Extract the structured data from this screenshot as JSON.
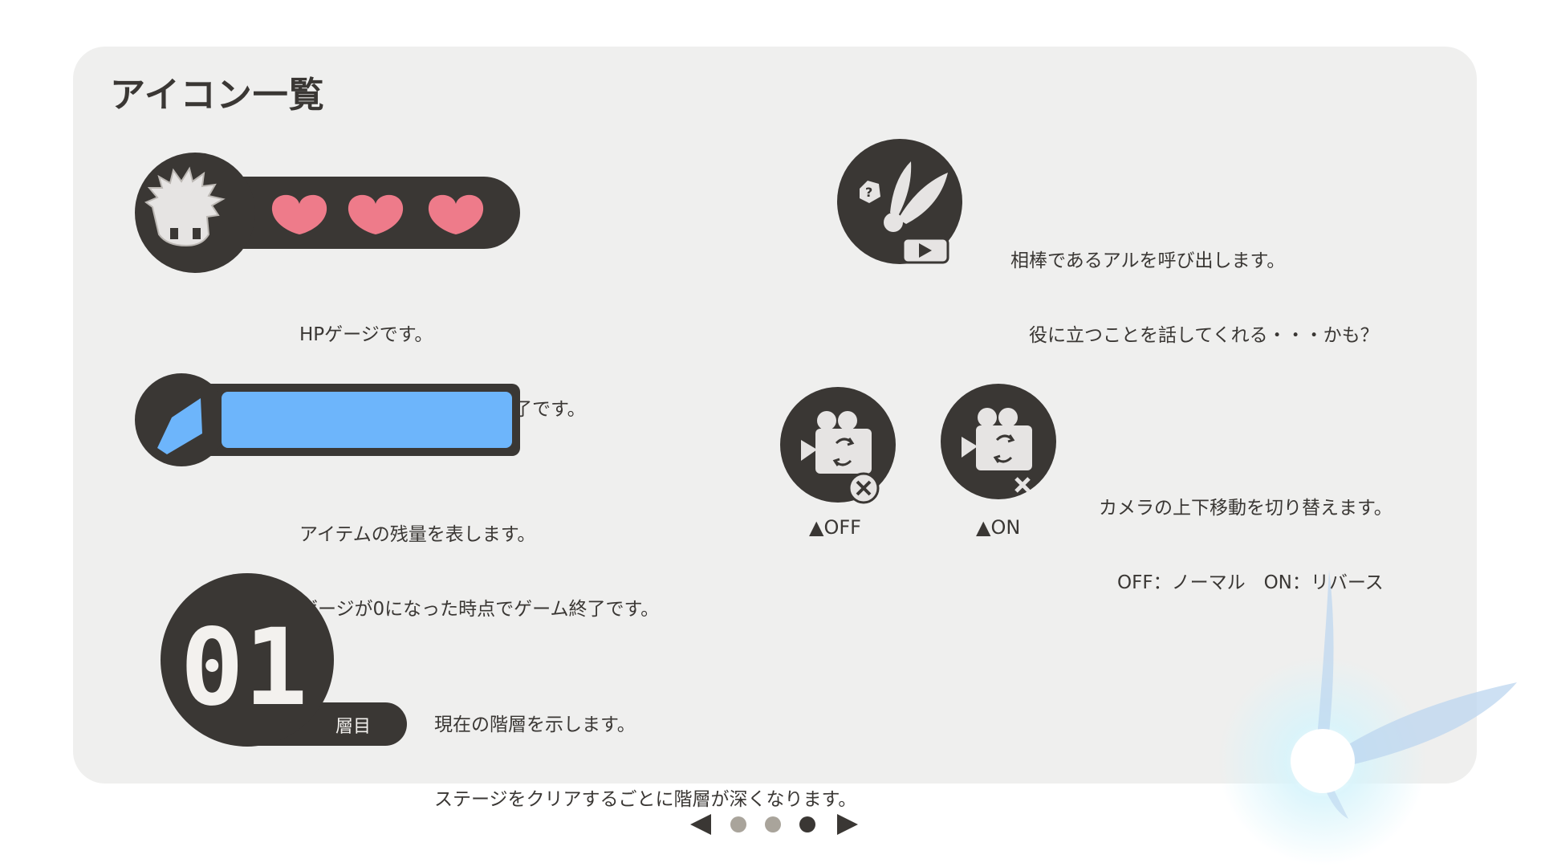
{
  "title": "アイコン一覧",
  "hp": {
    "hearts_filled": 3,
    "desc": [
      "HPゲージです。",
      "0になった時点でゲーム終了です。"
    ],
    "heart_color": "#ee7b8a"
  },
  "item": {
    "level": 1.0,
    "desc": [
      "アイテムの残量を表します。",
      "ゲージが0になった時点でゲーム終了です。"
    ],
    "fill_color": "#6db5fb"
  },
  "floor": {
    "number": "01",
    "unit": "層目",
    "desc": [
      "現在の階層を示します。",
      "ステージをクリアするごとに階層が深くなります。"
    ]
  },
  "partner": {
    "desc": [
      "相棒であるアルを呼び出します。",
      "　役に立つことを話してくれる・・・かも？"
    ]
  },
  "camera": {
    "off_label": "▲OFF",
    "on_label": "▲ON",
    "desc": [
      "カメラの上下移動を切り替えます。",
      "　OFF：ノーマル　ON：リバース"
    ]
  },
  "pager": {
    "pages": 3,
    "current": 3,
    "active_color": "#3a3734",
    "inactive_color": "#a9a49b"
  },
  "colors": {
    "dark": "#3a3734",
    "panel": "#efefee"
  }
}
